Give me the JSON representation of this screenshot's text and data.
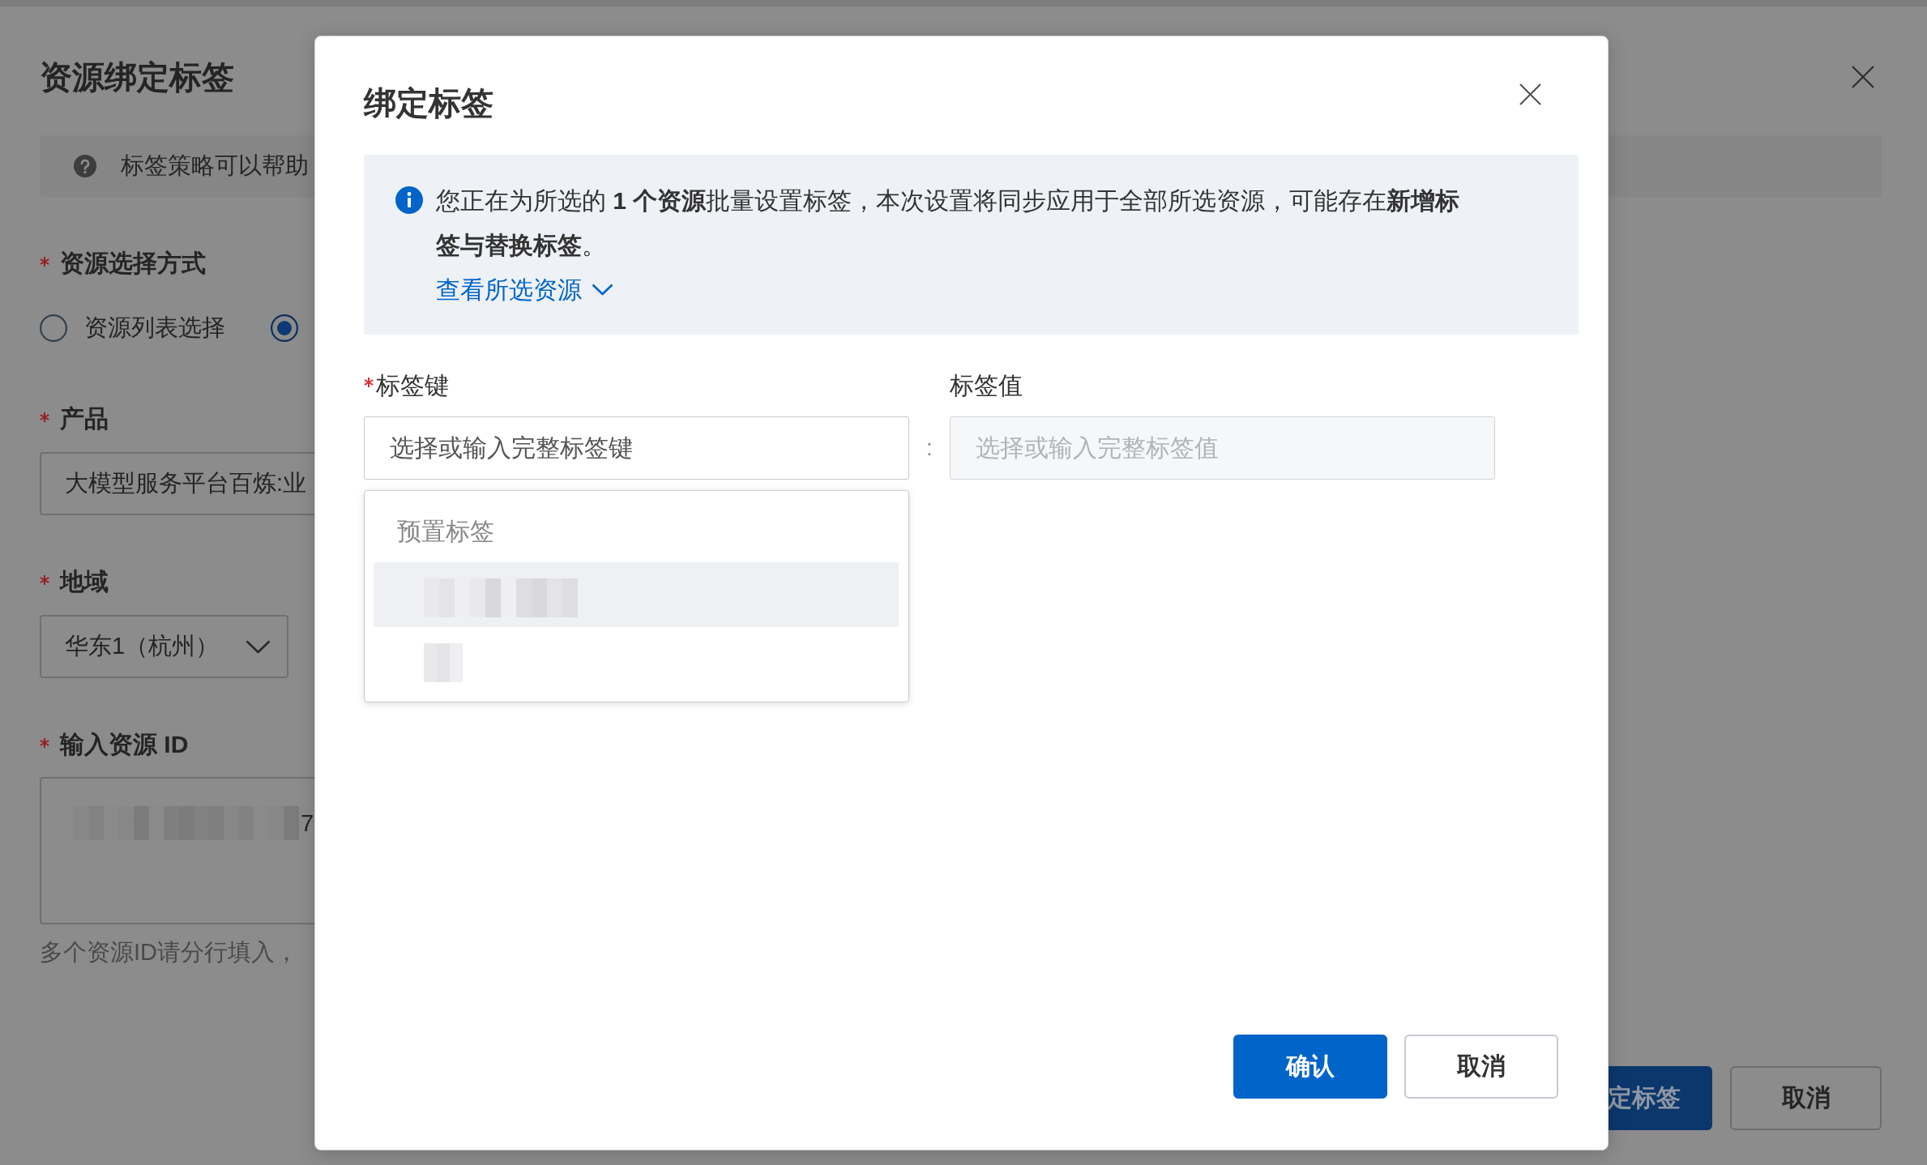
{
  "drawer": {
    "title": "资源绑定标签",
    "notice": "标签策略可以帮助",
    "fields": [
      {
        "kind": "radio",
        "label": "资源选择方式",
        "required": true,
        "options": [
          {
            "label": "资源列表选择",
            "selected": false
          },
          {
            "selected": true
          }
        ]
      },
      {
        "kind": "input",
        "label": "产品",
        "required": true,
        "value": "大模型服务平台百炼:业"
      },
      {
        "kind": "select",
        "label": "地域",
        "required": true,
        "value": "华东1（杭州）"
      },
      {
        "kind": "textarea",
        "label": "输入资源 ID",
        "required": true,
        "value": "7",
        "hint": "多个资源ID请分行填入，"
      }
    ],
    "buttons": [
      {
        "kind": "primary",
        "label": "定标签"
      },
      {
        "kind": "default",
        "label": "取消"
      }
    ]
  },
  "modal": {
    "title": "绑定标签",
    "info": {
      "text": "您正在为所选的 **1 个资源**批量设置标签，本次设置将同步应用于全部所选资源，可能存在**新增标签与替换标签**。",
      "link": "查看所选资源"
    },
    "key_field": {
      "label": "标签键",
      "required": true,
      "placeholder": "选择或输入完整标签键",
      "disabled": false
    },
    "separator": ":",
    "value_field": {
      "label": "标签值",
      "required": false,
      "placeholder": "选择或输入完整标签值",
      "disabled": true
    },
    "dropdown": {
      "group": "预置标签",
      "options": [
        {
          "kind": "wide",
          "selected": true
        },
        {
          "kind": "narrow",
          "selected": false
        }
      ]
    },
    "buttons": [
      {
        "kind": "primary",
        "label": "确认"
      },
      {
        "kind": "default",
        "label": "取消"
      }
    ]
  }
}
